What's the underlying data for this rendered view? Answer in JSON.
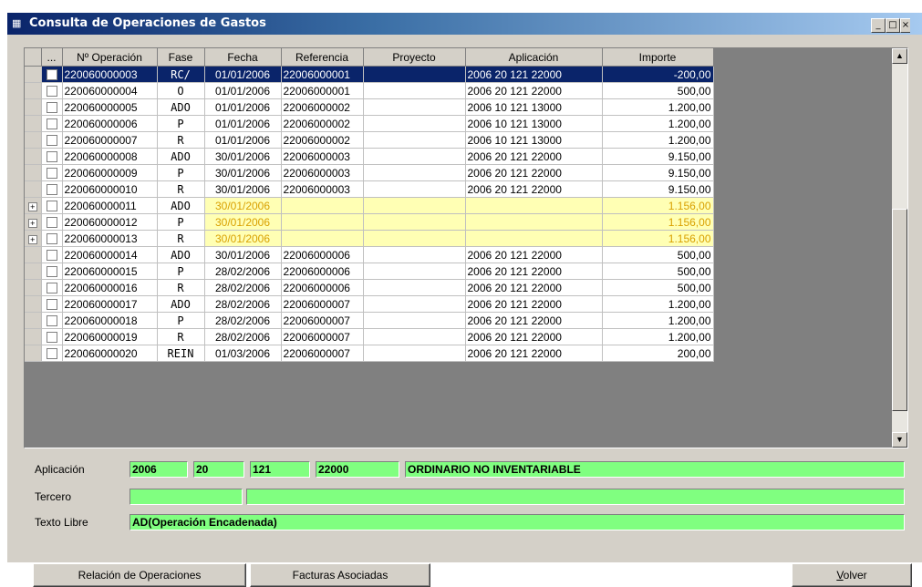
{
  "window": {
    "title": "Consulta de Operaciones de Gastos",
    "controls": [
      "_",
      "□",
      "×"
    ]
  },
  "grid": {
    "columns": [
      "...",
      "Nº Operación",
      "Fase",
      "Fecha",
      "Referencia",
      "Proyecto",
      "Aplicación",
      "Importe"
    ],
    "rows": [
      {
        "op": "220060000003",
        "fase": "RC/",
        "fecha": "01/01/2006",
        "ref": "22006000001",
        "proy": "",
        "apl": "2006 20 121 22000",
        "imp": "-200,00"
      },
      {
        "op": "220060000004",
        "fase": "O",
        "fecha": "01/01/2006",
        "ref": "22006000001",
        "proy": "",
        "apl": "2006 20 121 22000",
        "imp": "500,00"
      },
      {
        "op": "220060000005",
        "fase": "ADO",
        "fecha": "01/01/2006",
        "ref": "22006000002",
        "proy": "",
        "apl": "2006 10 121 13000",
        "imp": "1.200,00"
      },
      {
        "op": "220060000006",
        "fase": "P",
        "fecha": "01/01/2006",
        "ref": "22006000002",
        "proy": "",
        "apl": "2006 10 121 13000",
        "imp": "1.200,00"
      },
      {
        "op": "220060000007",
        "fase": "R",
        "fecha": "01/01/2006",
        "ref": "22006000002",
        "proy": "",
        "apl": "2006 10 121 13000",
        "imp": "1.200,00"
      },
      {
        "op": "220060000008",
        "fase": "ADO",
        "fecha": "30/01/2006",
        "ref": "22006000003",
        "proy": "",
        "apl": "2006 20 121 22000",
        "imp": "9.150,00"
      },
      {
        "op": "220060000009",
        "fase": "P",
        "fecha": "30/01/2006",
        "ref": "22006000003",
        "proy": "",
        "apl": "2006 20 121 22000",
        "imp": "9.150,00"
      },
      {
        "op": "220060000010",
        "fase": "R",
        "fecha": "30/01/2006",
        "ref": "22006000003",
        "proy": "",
        "apl": "2006 20 121 22000",
        "imp": "9.150,00"
      },
      {
        "op": "220060000011",
        "fase": "ADO",
        "fecha": "30/01/2006",
        "ref": "",
        "proy": "",
        "apl": "",
        "imp": "1.156,00"
      },
      {
        "op": "220060000012",
        "fase": "P",
        "fecha": "30/01/2006",
        "ref": "",
        "proy": "",
        "apl": "",
        "imp": "1.156,00"
      },
      {
        "op": "220060000013",
        "fase": "R",
        "fecha": "30/01/2006",
        "ref": "",
        "proy": "",
        "apl": "",
        "imp": "1.156,00"
      },
      {
        "op": "220060000014",
        "fase": "ADO",
        "fecha": "30/01/2006",
        "ref": "22006000006",
        "proy": "",
        "apl": "2006 20 121 22000",
        "imp": "500,00"
      },
      {
        "op": "220060000015",
        "fase": "P",
        "fecha": "28/02/2006",
        "ref": "22006000006",
        "proy": "",
        "apl": "2006 20 121 22000",
        "imp": "500,00"
      },
      {
        "op": "220060000016",
        "fase": "R",
        "fecha": "28/02/2006",
        "ref": "22006000006",
        "proy": "",
        "apl": "2006 20 121 22000",
        "imp": "500,00"
      },
      {
        "op": "220060000017",
        "fase": "ADO",
        "fecha": "28/02/2006",
        "ref": "22006000007",
        "proy": "",
        "apl": "2006 20 121 22000",
        "imp": "1.200,00"
      },
      {
        "op": "220060000018",
        "fase": "P",
        "fecha": "28/02/2006",
        "ref": "22006000007",
        "proy": "",
        "apl": "2006 20 121 22000",
        "imp": "1.200,00"
      },
      {
        "op": "220060000019",
        "fase": "R",
        "fecha": "28/02/2006",
        "ref": "22006000007",
        "proy": "",
        "apl": "2006 20 121 22000",
        "imp": "1.200,00"
      },
      {
        "op": "220060000020",
        "fase": "REIN",
        "fecha": "01/03/2006",
        "ref": "22006000007",
        "proy": "",
        "apl": "2006 20 121 22000",
        "imp": "200,00"
      }
    ]
  },
  "details": {
    "aplicacion_label": "Aplicación",
    "aplicacion_year": "2006",
    "aplicacion_org": "20",
    "aplicacion_func": "121",
    "aplicacion_econ": "22000",
    "aplicacion_desc": "ORDINARIO NO INVENTARIABLE",
    "tercero_label": "Tercero",
    "tercero_code": "",
    "tercero_name": "",
    "texto_label": "Texto Libre",
    "texto_value": "AD(Operación Encadenada)"
  },
  "buttons": {
    "relacion": "Relación de Operaciones",
    "facturas": "Facturas Asociadas",
    "volver": "Volver"
  },
  "colors": {
    "selected_row": "#0a246a",
    "highlight_row": "#ffffb4",
    "field_green": "#80ff80"
  }
}
